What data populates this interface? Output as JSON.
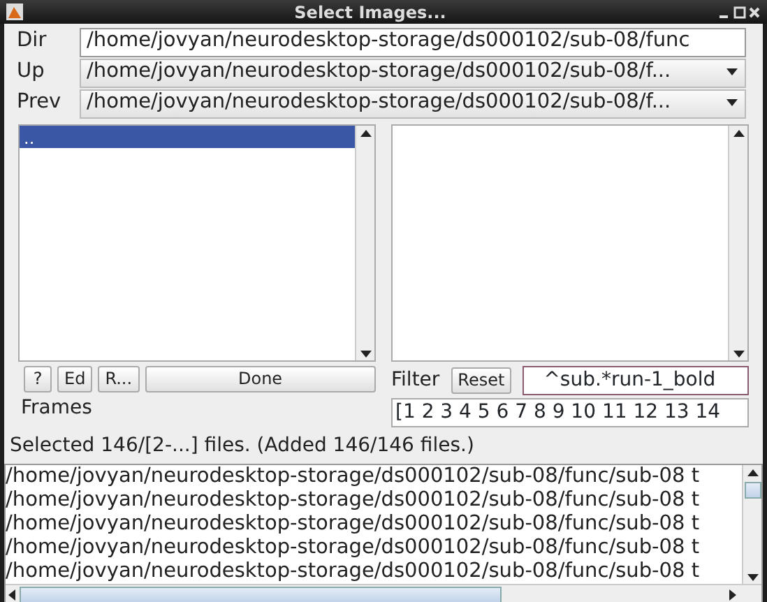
{
  "window": {
    "title": "Select Images..."
  },
  "paths": [
    {
      "label": "Dir",
      "kind": "text",
      "value": "/home/jovyan/neurodesktop-storage/ds000102/sub-08/func"
    },
    {
      "label": "Up",
      "kind": "dropdown",
      "value": "/home/jovyan/neurodesktop-storage/ds000102/sub-08/f..."
    },
    {
      "label": "Prev",
      "kind": "dropdown",
      "value": "/home/jovyan/neurodesktop-storage/ds000102/sub-08/f..."
    }
  ],
  "directories": [
    {
      "name": "..",
      "selected": true
    }
  ],
  "buttons": [
    "?",
    "Ed",
    "R...",
    "Done"
  ],
  "filter": {
    "label": "Filter",
    "reset": "Reset",
    "value": "^sub.*run-1_bold"
  },
  "frames": {
    "label": "Frames",
    "value": "[1 2 3 4 5 6 7 8 9 10 11 12 13 14"
  },
  "status": "Selected 146/[2-...] files. (Added 146/146 files.)",
  "selected_files": [
    "/home/jovyan/neurodesktop-storage/ds000102/sub-08/func/sub-08  t",
    "/home/jovyan/neurodesktop-storage/ds000102/sub-08/func/sub-08  t",
    "/home/jovyan/neurodesktop-storage/ds000102/sub-08/func/sub-08  t",
    "/home/jovyan/neurodesktop-storage/ds000102/sub-08/func/sub-08  t",
    "/home/jovyan/neurodesktop-storage/ds000102/sub-08/func/sub-08  t"
  ]
}
